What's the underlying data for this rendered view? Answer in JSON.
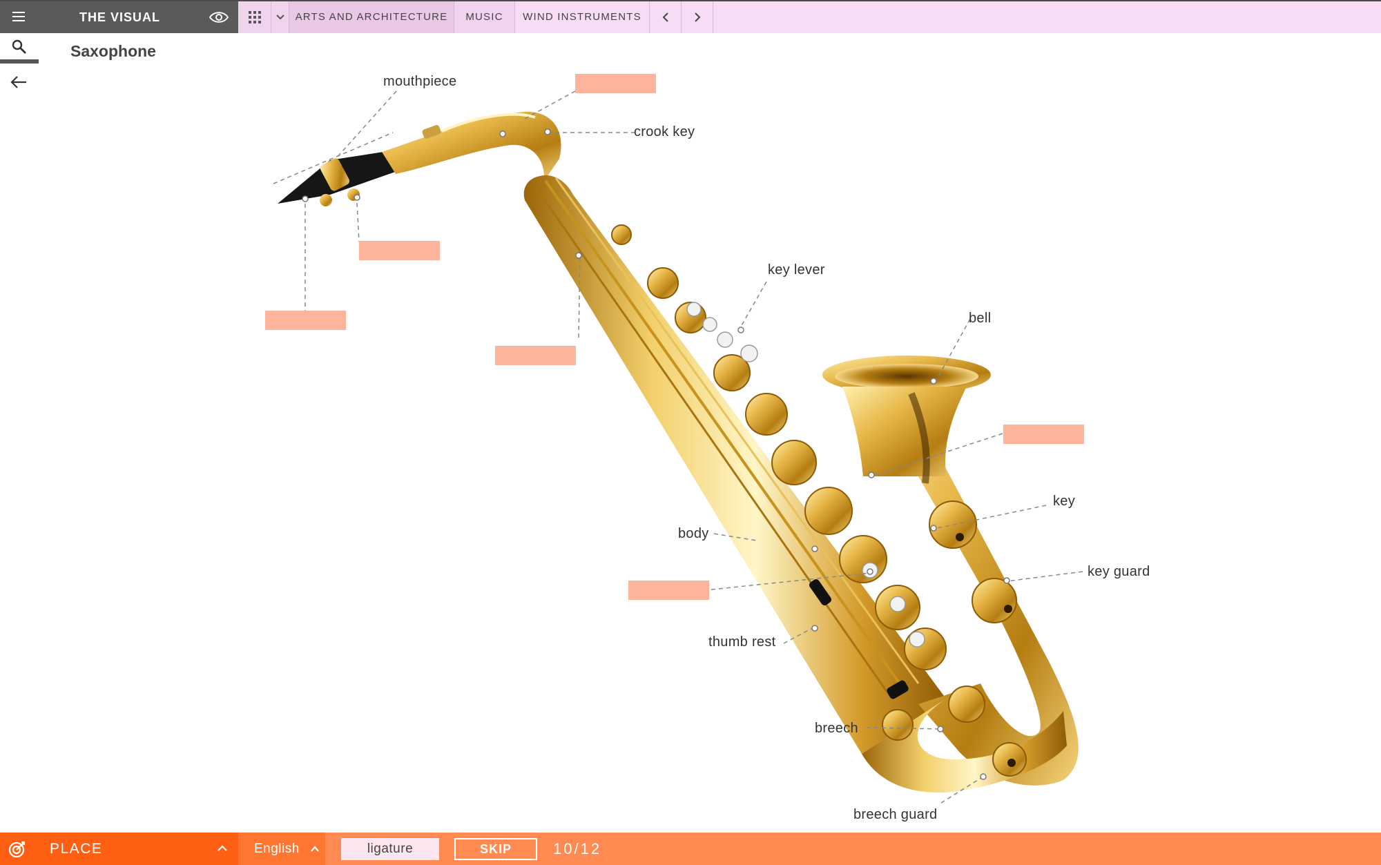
{
  "app": {
    "brand": "THE VISUAL"
  },
  "breadcrumbs": [
    "ARTS AND ARCHITECTURE",
    "MUSIC",
    "WIND INSTRUMENTS"
  ],
  "page": {
    "title": "Saxophone"
  },
  "labels": {
    "mouthpiece": "mouthpiece",
    "crook_key": "crook key",
    "key_lever": "key lever",
    "bell": "bell",
    "key": "key",
    "body": "body",
    "key_guard": "key guard",
    "thumb_rest": "thumb rest",
    "breech": "breech",
    "breech_guard": "breech guard"
  },
  "blanks_count": 6,
  "bottom": {
    "mode": "PLACE",
    "language": "English",
    "current_answer": "ligature",
    "skip": "SKIP",
    "progress": "10/12"
  },
  "colors": {
    "topbar": "#f6dcf5",
    "brand": "#5a5a5a",
    "bottombar": "#ff8b52",
    "mode": "#ff5f12",
    "blank": "#fdb49a",
    "brass": "#d4a032"
  }
}
